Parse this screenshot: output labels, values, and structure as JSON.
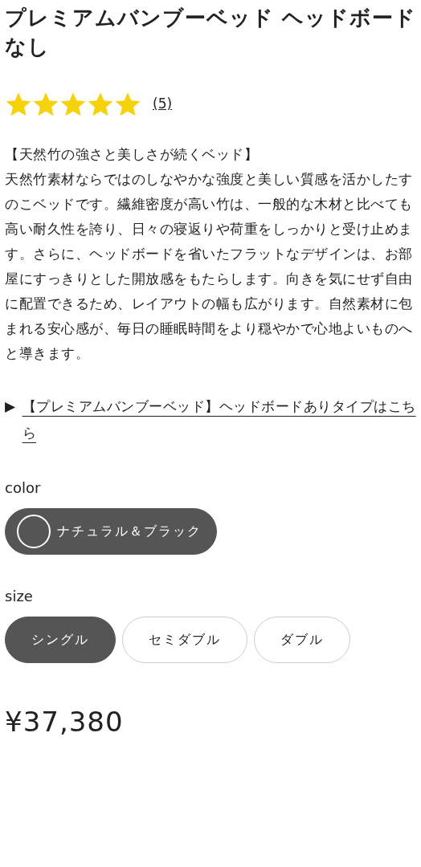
{
  "title": "プレミアムバンブーベッド ヘッドボードなし",
  "rating": {
    "stars": 5,
    "count": "(5)"
  },
  "description": {
    "heading": "【天然竹の強さと美しさが続くベッド】",
    "body": "天然竹素材ならではのしなやかな強度と美しい質感を活かしたすのこベッドです。繊維密度が高い竹は、一般的な木材と比べても高い耐久性を誇り、日々の寝返りや荷重をしっかりと受け止めます。さらに、ヘッドボードを省いたフラットなデザインは、お部屋にすっきりとした開放感をもたらします。向きを気にせず自由に配置できるため、レイアウトの幅も広がります。自然素材に包まれる安心感が、毎日の睡眠時間をより穏やかで心地よいものへと導きます。"
  },
  "link": {
    "marker": "▶",
    "text": "【プレミアムバンブーベッド】ヘッドボードありタイプはこちら"
  },
  "color": {
    "label": "color",
    "options": [
      {
        "label": "ナチュラル＆ブラック",
        "selected": true
      }
    ]
  },
  "size": {
    "label": "size",
    "options": [
      {
        "label": "シングル",
        "selected": true
      },
      {
        "label": "セミダブル",
        "selected": false
      },
      {
        "label": "ダブル",
        "selected": false
      }
    ]
  },
  "price": "¥37,380"
}
